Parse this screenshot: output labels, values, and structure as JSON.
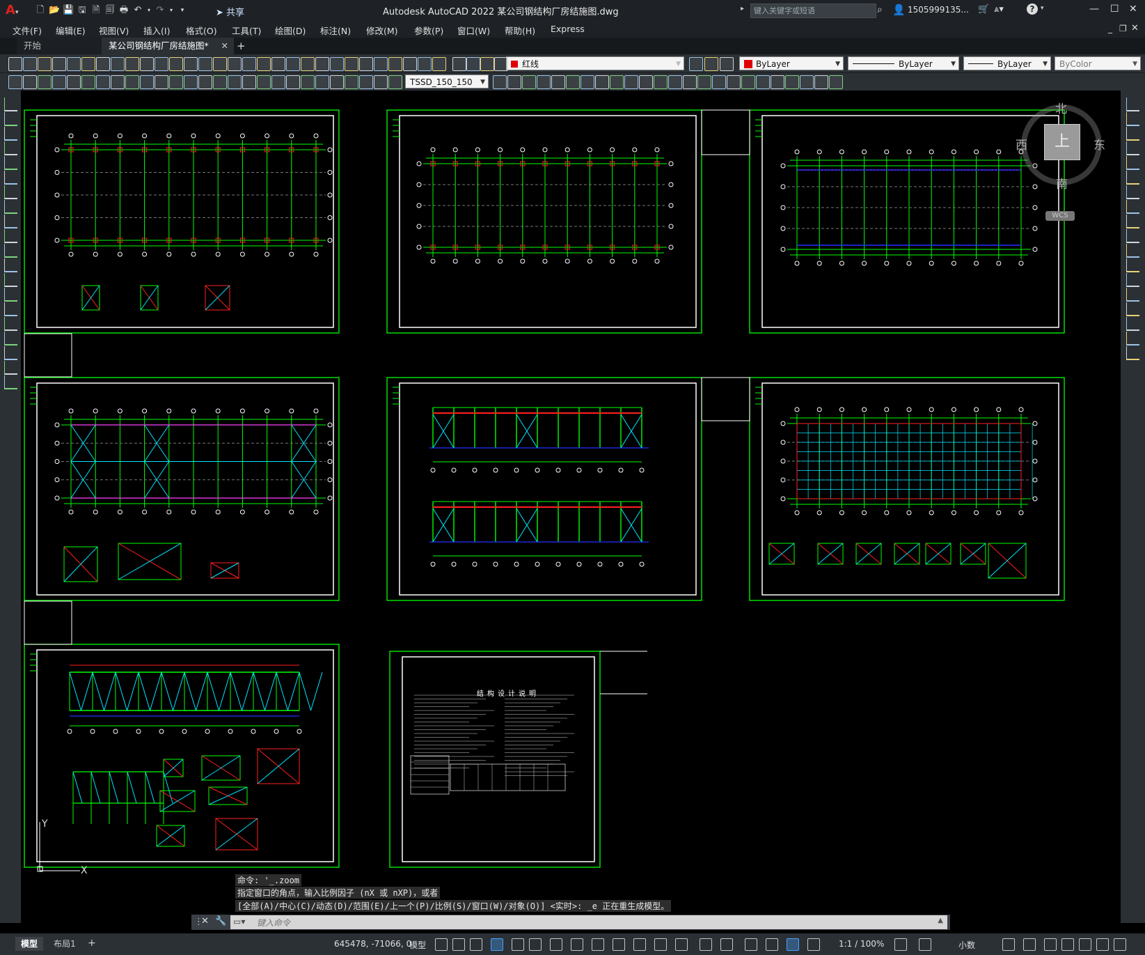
{
  "app": {
    "title": "Autodesk AutoCAD 2022    某公司钢结构厂房结施图.dwg",
    "share_label": "共享",
    "search_placeholder": "键入关键字或短语",
    "user_name": "1505999135..."
  },
  "menu": [
    "文件(F)",
    "编辑(E)",
    "视图(V)",
    "插入(I)",
    "格式(O)",
    "工具(T)",
    "绘图(D)",
    "标注(N)",
    "修改(M)",
    "参数(P)",
    "窗口(W)",
    "帮助(H)",
    "Express"
  ],
  "tabs": [
    {
      "label": "开始",
      "active": false
    },
    {
      "label": "某公司钢结构厂房结施图*",
      "active": true
    }
  ],
  "toolbar": {
    "layer_name": "红线",
    "layer_color": "#e00000",
    "color_value": "ByLayer",
    "linetype_value": "ByLayer",
    "lineweight_value": "ByLayer",
    "plotstyle_value": "ByColor",
    "dimstyle_value": "TSSD_150_150"
  },
  "viewcube": {
    "north": "北",
    "south": "南",
    "east": "东",
    "west": "西",
    "face": "上",
    "wcs": "WCS"
  },
  "ucs": {
    "y_label": "Y",
    "x_label": "X"
  },
  "sheet_title": "结构设计说明",
  "command_history": [
    "命令: '_.zoom",
    "指定窗口的角点，输入比例因子 (nX 或 nXP)，或者",
    "[全部(A)/中心(C)/动态(D)/范围(E)/上一个(P)/比例(S)/窗口(W)/对象(O)] <实时>: _e 正在重生成模型。"
  ],
  "command_placeholder": "键入命令",
  "layout_tabs": [
    {
      "label": "模型",
      "active": true
    },
    {
      "label": "布局1",
      "active": false
    }
  ],
  "status": {
    "coords": "645478, -71066, 0",
    "space": "模型",
    "annotation_scale": "1:1 / 100%",
    "units": "小数"
  },
  "colors": {
    "drawing_green": "#00ff00",
    "frame_white": "#ffffff",
    "red": "#ff2020",
    "cyan": "#00e5ff",
    "blue": "#2030ff",
    "magenta": "#ff40ff"
  }
}
